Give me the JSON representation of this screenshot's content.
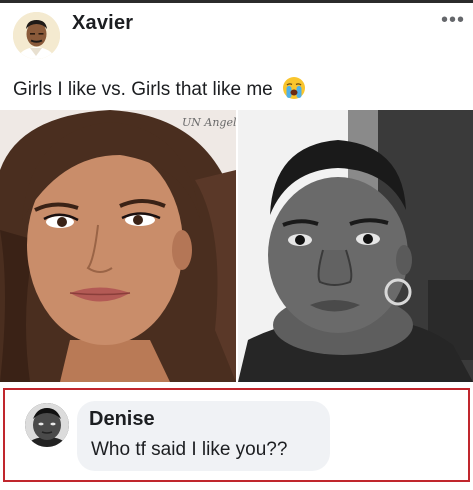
{
  "post": {
    "author": "Xavier",
    "more_icon": "more-horizontal-icon",
    "caption": "Girls I like vs. Girls that like me",
    "caption_emoji": "crying-face-emoji",
    "images": [
      {
        "name": "photo-girls-i-like"
      },
      {
        "name": "photo-girls-that-like-me"
      }
    ],
    "photo_watermark": "UN Angeles"
  },
  "comment": {
    "author": "Denise",
    "text": "Who tf said I like you??",
    "highlight_color": "#c0262d"
  },
  "colors": {
    "text": "#1c1e21",
    "bubble": "#f0f2f5",
    "muted": "#65676b"
  }
}
